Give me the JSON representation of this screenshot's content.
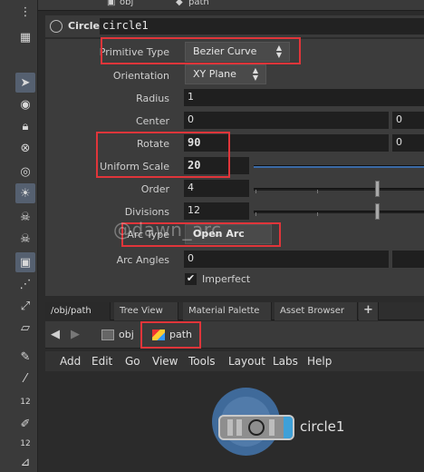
{
  "topbar": {
    "left_label": "obj",
    "right_label": "path"
  },
  "node": {
    "type": "Circle",
    "name": "circle1"
  },
  "params": {
    "primitive_type": {
      "label": "Primitive Type",
      "value": "Bezier Curve"
    },
    "orientation": {
      "label": "Orientation",
      "value": "XY Plane"
    },
    "radius": {
      "label": "Radius",
      "v1": "1"
    },
    "center": {
      "label": "Center",
      "v1": "0",
      "v2": "0"
    },
    "rotate": {
      "label": "Rotate",
      "v1": "90",
      "v2": "0"
    },
    "uniform_scale": {
      "label": "Uniform Scale",
      "value": "20"
    },
    "order": {
      "label": "Order",
      "value": "4"
    },
    "divisions": {
      "label": "Divisions",
      "value": "12"
    },
    "arc_type": {
      "label": "Arc Type",
      "value": "Open Arc"
    },
    "arc_angles": {
      "label": "Arc Angles",
      "v1": "0"
    },
    "imperfect": {
      "label": "Imperfect",
      "checked": true
    }
  },
  "tabs": [
    {
      "label": "/obj/path"
    },
    {
      "label": "Tree View"
    },
    {
      "label": "Material Palette"
    },
    {
      "label": "Asset Browser"
    },
    {
      "label": "+"
    }
  ],
  "pathbar": {
    "crumb1": "obj",
    "crumb2": "path"
  },
  "menus": [
    "Add",
    "Edit",
    "Go",
    "View",
    "Tools",
    "Layout",
    "Labs",
    "Help"
  ],
  "network": {
    "node_label": "circle1"
  },
  "watermark": "@dawn_arc",
  "left_tools": {
    "num1": "12",
    "num2": "12"
  },
  "colors": {
    "highlight": "#e0353a",
    "node_blue": "#3ea0d8"
  }
}
